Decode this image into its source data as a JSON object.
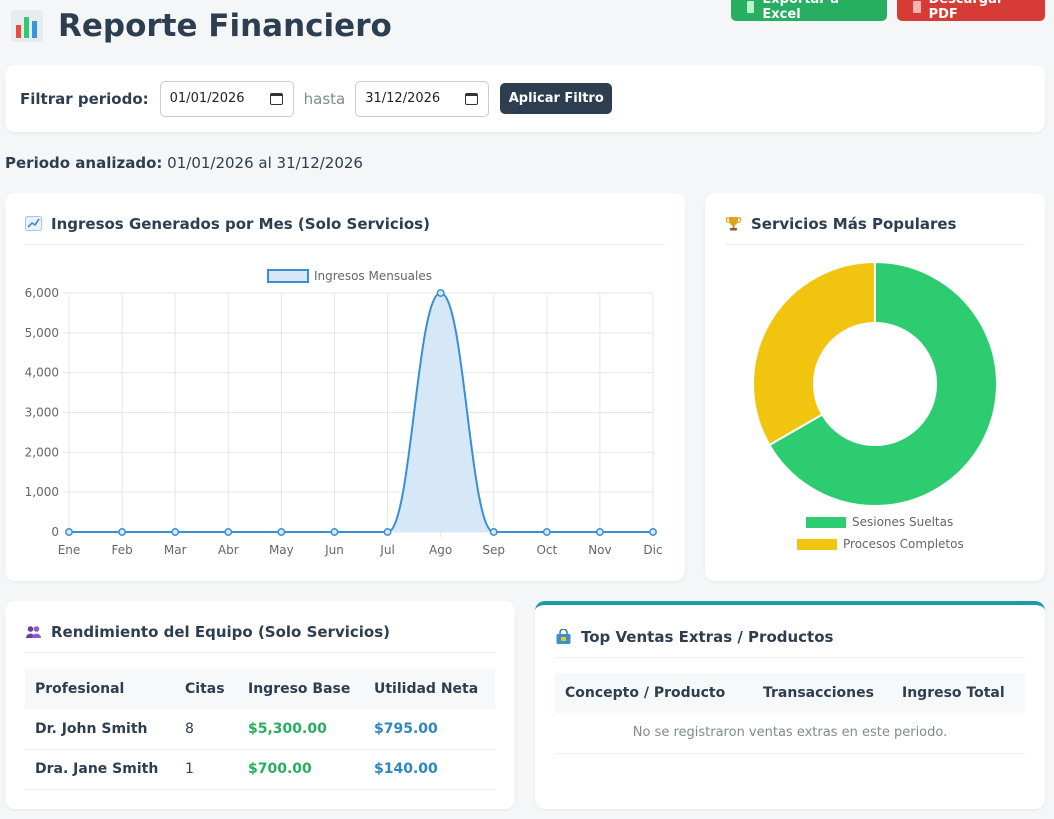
{
  "header": {
    "title": "Reporte Financiero",
    "icon": "bar-chart-icon",
    "export_excel_label": "Exportar a Excel",
    "export_pdf_label": "Descargar PDF"
  },
  "filter": {
    "label": "Filtrar periodo:",
    "from_value": "01/01/2026",
    "separator": "hasta",
    "to_value": "31/12/2026",
    "apply_label": "Aplicar Filtro"
  },
  "period": {
    "label": "Periodo analizado:",
    "value": "01/01/2026 al 31/12/2026"
  },
  "income_card": {
    "title": "Ingresos Generados por Mes (Solo Servicios)",
    "icon": "line-chart-icon"
  },
  "popular_card": {
    "title": "Servicios Más Populares",
    "icon": "trophy-icon"
  },
  "team_card": {
    "title": "Rendimiento del Equipo (Solo Servicios)",
    "icon": "team-icon",
    "columns": [
      "Profesional",
      "Citas",
      "Ingreso Base",
      "Utilidad Neta"
    ],
    "rows": [
      {
        "name": "Dr. John Smith",
        "citas": "8",
        "base": "$5,300.00",
        "net": "$795.00"
      },
      {
        "name": "Dra. Jane Smith",
        "citas": "1",
        "base": "$700.00",
        "net": "$140.00"
      }
    ]
  },
  "extras_card": {
    "title": "Top Ventas Extras / Productos",
    "icon": "shopping-bag-icon",
    "columns": [
      "Concepto / Producto",
      "Transacciones",
      "Ingreso Total"
    ],
    "empty_message": "No se registraron ventas extras en este periodo."
  },
  "colors": {
    "excel": "#27ae60",
    "pdf": "#d63c35",
    "line": "#3a8fd0",
    "line_fill": "#d6e8f7",
    "green": "#2ecc71",
    "yellow": "#f1c40f"
  },
  "chart_data": [
    {
      "type": "area",
      "legend": "Ingresos Mensuales",
      "legend_position": "top",
      "categories": [
        "Ene",
        "Feb",
        "Mar",
        "Abr",
        "May",
        "Jun",
        "Jul",
        "Ago",
        "Sep",
        "Oct",
        "Nov",
        "Dic"
      ],
      "values": [
        0,
        0,
        0,
        0,
        0,
        0,
        0,
        6000,
        0,
        0,
        0,
        0
      ],
      "y_ticks": [
        "0",
        "1,000",
        "2,000",
        "3,000",
        "4,000",
        "5,000",
        "6,000"
      ],
      "ylim": [
        0,
        6000
      ],
      "grid": true
    },
    {
      "type": "pie",
      "legend_position": "bottom",
      "labels": [
        "Sesiones Sueltas",
        "Procesos Completos"
      ],
      "values": [
        8,
        4
      ]
    }
  ]
}
